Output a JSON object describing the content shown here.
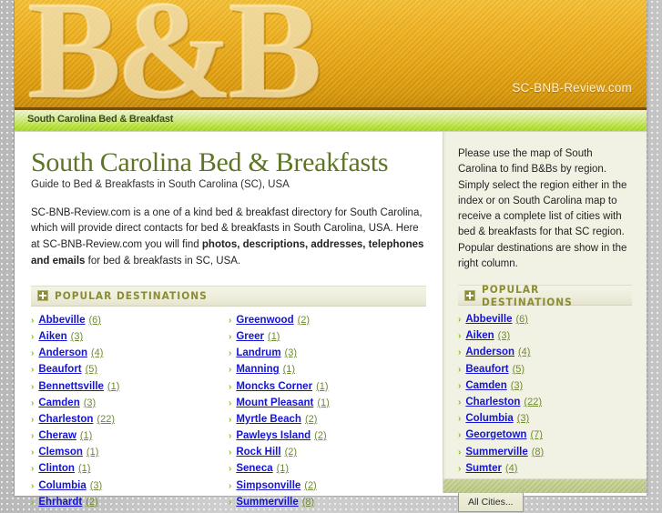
{
  "header": {
    "logo_text": "B&B",
    "watermark": "SC-BNB-Review.com",
    "nav_title": "South Carolina Bed & Breakfast"
  },
  "main": {
    "title": "South Carolina Bed & Breakfasts",
    "subtitle": "Guide to Bed & Breakfasts in South Carolina (SC), USA",
    "intro_part1": "SC-BNB-Review.com is a one of a kind bed & breakfast directory for South Carolina, which will provide direct contacts for bed & breakfasts in South Carolina, USA. Here at SC-BNB-Review.com you will find ",
    "intro_bold": "photos, descriptions, addresses, telephones and emails",
    "intro_part2": " for bed & breakfasts in SC, USA.",
    "section_title": "POPULAR DESTINATIONS",
    "section_icon": "plus-square-icon",
    "destinations_left": [
      {
        "name": "Abbeville",
        "count": "(6)"
      },
      {
        "name": "Aiken",
        "count": "(3)"
      },
      {
        "name": "Anderson",
        "count": "(4)"
      },
      {
        "name": "Beaufort",
        "count": "(5)"
      },
      {
        "name": "Bennettsville",
        "count": "(1)"
      },
      {
        "name": "Camden",
        "count": "(3)"
      },
      {
        "name": "Charleston",
        "count": "(22)"
      },
      {
        "name": "Cheraw",
        "count": "(1)"
      },
      {
        "name": "Clemson",
        "count": "(1)"
      },
      {
        "name": "Clinton",
        "count": "(1)"
      },
      {
        "name": "Columbia",
        "count": "(3)"
      },
      {
        "name": "Ehrhardt",
        "count": "(2)"
      }
    ],
    "destinations_right": [
      {
        "name": "Greenwood",
        "count": "(2)"
      },
      {
        "name": "Greer",
        "count": "(1)"
      },
      {
        "name": "Landrum",
        "count": "(3)"
      },
      {
        "name": "Manning",
        "count": "(1)"
      },
      {
        "name": "Moncks Corner",
        "count": "(1)"
      },
      {
        "name": "Mount Pleasant",
        "count": "(1)"
      },
      {
        "name": "Myrtle Beach",
        "count": "(2)"
      },
      {
        "name": "Pawleys Island",
        "count": "(2)"
      },
      {
        "name": "Rock Hill",
        "count": "(2)"
      },
      {
        "name": "Seneca",
        "count": "(1)"
      },
      {
        "name": "Simpsonville",
        "count": "(2)"
      },
      {
        "name": "Summerville",
        "count": "(8)"
      }
    ]
  },
  "sidebar": {
    "intro": "Please use the map of South Carolina to find B&Bs by region. Simply select the region either in the index or on South Carolina map to receive a complete list of cities with bed & breakfasts for that SC region. Popular destinations are show in the right column.",
    "section_title": "POPULAR DESTINATIONS",
    "section_icon": "plus-square-icon",
    "destinations": [
      {
        "name": "Abbeville",
        "count": "(6)"
      },
      {
        "name": "Aiken",
        "count": "(3)"
      },
      {
        "name": "Anderson",
        "count": "(4)"
      },
      {
        "name": "Beaufort",
        "count": "(5)"
      },
      {
        "name": "Camden",
        "count": "(3)"
      },
      {
        "name": "Charleston",
        "count": "(22)"
      },
      {
        "name": "Columbia",
        "count": "(3)"
      },
      {
        "name": "Georgetown",
        "count": "(7)"
      },
      {
        "name": "Summerville",
        "count": "(8)"
      },
      {
        "name": "Sumter",
        "count": "(4)"
      }
    ],
    "all_cities_label": "All Cities..."
  },
  "icons": {
    "bullet": "›"
  },
  "colors": {
    "header_gold": "#e6a413",
    "nav_green": "#b5e234",
    "title_green": "#5d7524",
    "link_blue": "#1414d2",
    "count_olive": "#6f8a33",
    "section_olive": "#8c8c34"
  }
}
